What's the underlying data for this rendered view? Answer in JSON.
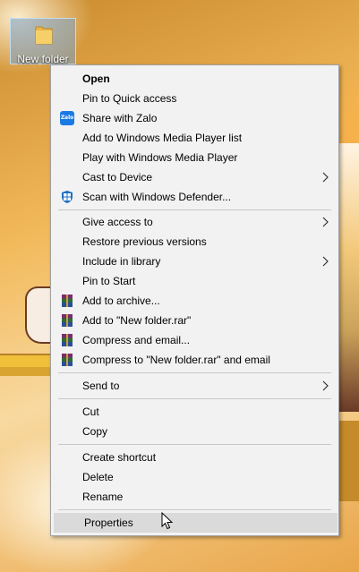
{
  "desktop": {
    "folder_name": "New folder"
  },
  "context_menu": {
    "groups": [
      [
        {
          "label": "Open",
          "bold": true
        },
        {
          "label": "Pin to Quick access"
        },
        {
          "label": "Share with Zalo",
          "icon": "zalo-icon"
        },
        {
          "label": "Add to Windows Media Player list"
        },
        {
          "label": "Play with Windows Media Player"
        },
        {
          "label": "Cast to Device",
          "submenu": true
        },
        {
          "label": "Scan with Windows Defender...",
          "icon": "windows-defender-icon"
        }
      ],
      [
        {
          "label": "Give access to",
          "submenu": true
        },
        {
          "label": "Restore previous versions"
        },
        {
          "label": "Include in library",
          "submenu": true
        },
        {
          "label": "Pin to Start"
        },
        {
          "label": "Add to archive...",
          "icon": "winrar-icon"
        },
        {
          "label": "Add to \"New folder.rar\"",
          "icon": "winrar-icon"
        },
        {
          "label": "Compress and email...",
          "icon": "winrar-icon"
        },
        {
          "label": "Compress to \"New folder.rar\" and email",
          "icon": "winrar-icon"
        }
      ],
      [
        {
          "label": "Send to",
          "submenu": true
        }
      ],
      [
        {
          "label": "Cut"
        },
        {
          "label": "Copy"
        }
      ],
      [
        {
          "label": "Create shortcut"
        },
        {
          "label": "Delete"
        },
        {
          "label": "Rename"
        }
      ],
      [
        {
          "label": "Properties",
          "hovered": true
        }
      ]
    ]
  },
  "colors": {
    "menu_background": "#f2f2f2",
    "hover_background": "#dadada",
    "zalo_blue": "#1a7ae3"
  }
}
